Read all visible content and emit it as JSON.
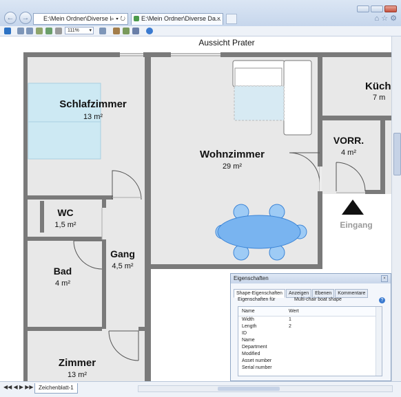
{
  "browser": {
    "address_text": "E:\\Mein Ordner\\Diverse Datei",
    "address_icons": "⌕ ▾ ↻",
    "tab_title": "E:\\Mein Ordner\\Diverse Da...",
    "zoom": "111%"
  },
  "plan": {
    "title": "Aussicht Prater",
    "entrance_label": "Eingang",
    "rooms": [
      {
        "name": "Schlafzimmer",
        "area": "13 m²"
      },
      {
        "name": "Wohnzimmer",
        "area": "29 m²"
      },
      {
        "name": "Küch",
        "area": "7 m"
      },
      {
        "name": "VORR.",
        "area": "4 m²"
      },
      {
        "name": "WC",
        "area": "1,5 m²"
      },
      {
        "name": "Gang",
        "area": "4,5 m²"
      },
      {
        "name": "Bad",
        "area": "4 m²"
      },
      {
        "name": "Zimmer",
        "area": "13 m²"
      }
    ]
  },
  "sheet_tab": "Zeichenblatt-1",
  "properties_panel": {
    "title": "Eigenschaften",
    "tabs": [
      "Shape-Eigenschaften",
      "Anzeigen",
      "Ebenen",
      "Kommentare"
    ],
    "properties_for_label": "Eigenschaften für",
    "properties_for_value": "Multi-chair boat shape",
    "header": {
      "name": "Name",
      "value": "Wert"
    },
    "rows": [
      {
        "name": "Width",
        "value": "1"
      },
      {
        "name": "Length",
        "value": "2"
      },
      {
        "name": "ID",
        "value": ""
      },
      {
        "name": "Name",
        "value": ""
      },
      {
        "name": "Department",
        "value": ""
      },
      {
        "name": "Modified",
        "value": ""
      },
      {
        "name": "Asset number",
        "value": ""
      },
      {
        "name": "Serial number",
        "value": ""
      }
    ]
  },
  "colors": {
    "wall": "#7a7a7a",
    "floor": "#e8e8e8",
    "bed": "#cde9f3",
    "table": "#79b4f0"
  }
}
